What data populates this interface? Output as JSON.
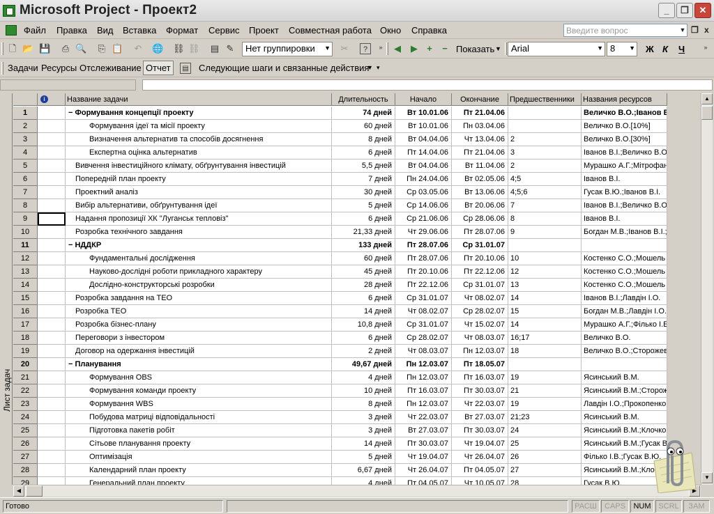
{
  "window": {
    "title": "Microsoft Project - Проект2"
  },
  "menu": [
    "Файл",
    "Правка",
    "Вид",
    "Вставка",
    "Формат",
    "Сервис",
    "Проект",
    "Совместная работа",
    "Окно",
    "Справка"
  ],
  "ask": {
    "placeholder": "Введите вопрос"
  },
  "toolbar": {
    "grouping": "Нет группировки",
    "show_label": "Показать",
    "font": "Arial",
    "font_size": "8",
    "bold_label": "Ж",
    "italic_label": "К",
    "underline_label": "Ч"
  },
  "project_guide": {
    "tabs": [
      "Задачи",
      "Ресурсы",
      "Отслеживание",
      "Отчет"
    ],
    "next_steps": "Следующие шаги и связанные действия"
  },
  "view_bar": {
    "label": "Лист задач"
  },
  "table": {
    "headers": [
      "Название задачи",
      "Длительность",
      "Начало",
      "Окончание",
      "Предшественники",
      "Названия ресурсов"
    ],
    "rows": [
      {
        "id": "1",
        "name": "Формування концепції проекту",
        "duration": "74 дней",
        "start": "Вт 10.01.06",
        "finish": "Пт 21.04.06",
        "pred": "",
        "res": "Величко В.О.;Іванов В",
        "summary": true,
        "level": 0
      },
      {
        "id": "2",
        "name": "Формування ідеї та місії  проекту",
        "duration": "60 дней",
        "start": "Вт 10.01.06",
        "finish": "Пн 03.04.06",
        "pred": "",
        "res": "Величко В.О.[10%]",
        "summary": false,
        "level": 2
      },
      {
        "id": "3",
        "name": "Визначення альтернатив та способів досягнення",
        "duration": "8 дней",
        "start": "Вт 04.04.06",
        "finish": "Чт 13.04.06",
        "pred": "2",
        "res": "Величко В.О.[30%]",
        "summary": false,
        "level": 2
      },
      {
        "id": "4",
        "name": "Експертна оцінка альтернатив",
        "duration": "6 дней",
        "start": "Пт 14.04.06",
        "finish": "Пт 21.04.06",
        "pred": "3",
        "res": "Іванов В.І.;Величко В.О",
        "summary": false,
        "level": 2
      },
      {
        "id": "5",
        "name": "Вивчення інвестиційного клімату, обґрунтування інвестицій",
        "duration": "5,5 дней",
        "start": "Вт 04.04.06",
        "finish": "Вт 11.04.06",
        "pred": "2",
        "res": "Мурашко А.Г.;Мітрофан",
        "summary": false,
        "level": 1
      },
      {
        "id": "6",
        "name": "Попередній план проекту",
        "duration": "7 дней",
        "start": "Пн 24.04.06",
        "finish": "Вт 02.05.06",
        "pred": "4;5",
        "res": "Іванов В.І.",
        "summary": false,
        "level": 1
      },
      {
        "id": "7",
        "name": "Проектний аналіз",
        "duration": "30 дней",
        "start": "Ср 03.05.06",
        "finish": "Вт 13.06.06",
        "pred": "4;5;6",
        "res": "Гусак В.Ю.;Іванов В.І.",
        "summary": false,
        "level": 1
      },
      {
        "id": "8",
        "name": "Вибір альтернативи, обґрунтування ідеї",
        "duration": "5 дней",
        "start": "Ср 14.06.06",
        "finish": "Вт 20.06.06",
        "pred": "7",
        "res": "Іванов В.І.;Величко В.О",
        "summary": false,
        "level": 1
      },
      {
        "id": "9",
        "name": "Надання пропозиції ХК \"Луганськ тепловіз\"",
        "duration": "6 дней",
        "start": "Ср 21.06.06",
        "finish": "Ср 28.06.06",
        "pred": "8",
        "res": "Іванов В.І.",
        "summary": false,
        "level": 1
      },
      {
        "id": "10",
        "name": "Розробка технічного завдання",
        "duration": "21,33 дней",
        "start": "Чт 29.06.06",
        "finish": "Пт 28.07.06",
        "pred": "9",
        "res": "Богдан М.В.;Іванов В.І.;",
        "summary": false,
        "level": 1
      },
      {
        "id": "11",
        "name": "НДДКР",
        "duration": "133 дней",
        "start": "Пт 28.07.06",
        "finish": "Ср 31.01.07",
        "pred": "",
        "res": "",
        "summary": true,
        "level": 0
      },
      {
        "id": "12",
        "name": "Фундаментальні дослідження",
        "duration": "60 дней",
        "start": "Пт 28.07.06",
        "finish": "Пт 20.10.06",
        "pred": "10",
        "res": "Костенко С.О.;Мошель",
        "summary": false,
        "level": 2
      },
      {
        "id": "13",
        "name": "Науково-дослідні роботи прикладного характеру",
        "duration": "45 дней",
        "start": "Пт 20.10.06",
        "finish": "Пт 22.12.06",
        "pred": "12",
        "res": "Костенко С.О.;Мошель",
        "summary": false,
        "level": 2
      },
      {
        "id": "14",
        "name": "Дослідно-конструкторські розробки",
        "duration": "28 дней",
        "start": "Пт 22.12.06",
        "finish": "Ср 31.01.07",
        "pred": "13",
        "res": "Костенко С.О.;Мошель",
        "summary": false,
        "level": 2
      },
      {
        "id": "15",
        "name": "Розробка завдання на ТЕО",
        "duration": "6 дней",
        "start": "Ср 31.01.07",
        "finish": "Чт 08.02.07",
        "pred": "14",
        "res": "Іванов В.І.;Лавдін І.О.",
        "summary": false,
        "level": 1
      },
      {
        "id": "16",
        "name": "Розробка ТЕО",
        "duration": "14 дней",
        "start": "Чт 08.02.07",
        "finish": "Ср 28.02.07",
        "pred": "15",
        "res": "Богдан М.В.;Лавдін І.О.;",
        "summary": false,
        "level": 1
      },
      {
        "id": "17",
        "name": "Розробка бізнес-плану",
        "duration": "10,8 дней",
        "start": "Ср 31.01.07",
        "finish": "Чт 15.02.07",
        "pred": "14",
        "res": "Мурашко А.Г.;Філько І.Е",
        "summary": false,
        "level": 1
      },
      {
        "id": "18",
        "name": "Переговори з інвестором",
        "duration": "6 дней",
        "start": "Ср 28.02.07",
        "finish": "Чт 08.03.07",
        "pred": "16;17",
        "res": "Величко В.О.",
        "summary": false,
        "level": 1
      },
      {
        "id": "19",
        "name": "Договор на одержання інвестицій",
        "duration": "2 дней",
        "start": "Чт 08.03.07",
        "finish": "Пн 12.03.07",
        "pred": "18",
        "res": "Величко В.О.;Сторожев",
        "summary": false,
        "level": 1
      },
      {
        "id": "20",
        "name": "Планування",
        "duration": "49,67 дней",
        "start": "Пн 12.03.07",
        "finish": "Пт 18.05.07",
        "pred": "",
        "res": "",
        "summary": true,
        "level": 0
      },
      {
        "id": "21",
        "name": "Формування OBS",
        "duration": "4 дней",
        "start": "Пн 12.03.07",
        "finish": "Пт 16.03.07",
        "pred": "19",
        "res": "Ясинський В.М.",
        "summary": false,
        "level": 2
      },
      {
        "id": "22",
        "name": "Формування команди проекту",
        "duration": "10 дней",
        "start": "Пт 16.03.07",
        "finish": "Пт 30.03.07",
        "pred": "21",
        "res": "Ясинський В.М.;Сторож",
        "summary": false,
        "level": 2
      },
      {
        "id": "23",
        "name": "Формування WBS",
        "duration": "8 дней",
        "start": "Пн 12.03.07",
        "finish": "Чт 22.03.07",
        "pred": "19",
        "res": "Лавдін І.О.;Прокопенко",
        "summary": false,
        "level": 2
      },
      {
        "id": "24",
        "name": "Побудова матриці відповідальності",
        "duration": "3 дней",
        "start": "Чт 22.03.07",
        "finish": "Вт 27.03.07",
        "pred": "21;23",
        "res": "Ясинський В.М.",
        "summary": false,
        "level": 2
      },
      {
        "id": "25",
        "name": "Підготовка пакетів робіт",
        "duration": "3 дней",
        "start": "Вт 27.03.07",
        "finish": "Пт 30.03.07",
        "pred": "24",
        "res": "Ясинський В.М.;Клочко",
        "summary": false,
        "level": 2
      },
      {
        "id": "26",
        "name": "Сітьове планування проекту",
        "duration": "14 дней",
        "start": "Пт 30.03.07",
        "finish": "Чт 19.04.07",
        "pred": "25",
        "res": "Ясинський В.М.;Гусак В.",
        "summary": false,
        "level": 2
      },
      {
        "id": "27",
        "name": "Оптимізація",
        "duration": "5 дней",
        "start": "Чт 19.04.07",
        "finish": "Чт 26.04.07",
        "pred": "26",
        "res": "Філько І.В.;Гусак В.Ю.",
        "summary": false,
        "level": 2
      },
      {
        "id": "28",
        "name": "Календарний план проекту",
        "duration": "6,67 дней",
        "start": "Чт 26.04.07",
        "finish": "Пт 04.05.07",
        "pred": "27",
        "res": "Ясинський В.М.;Клочко",
        "summary": false,
        "level": 2
      },
      {
        "id": "29",
        "name": "Генеральний план проекту",
        "duration": "4 дней",
        "start": "Пт 04.05.07",
        "finish": "Чт 10.05.07",
        "pred": "28",
        "res": "Гусак В.Ю.",
        "summary": false,
        "level": 2
      }
    ]
  },
  "status": {
    "text": "Готово",
    "indicators": [
      {
        "label": "РАСШ",
        "active": false
      },
      {
        "label": "CAPS",
        "active": false
      },
      {
        "label": "NUM",
        "active": true
      },
      {
        "label": "SCRL",
        "active": false
      },
      {
        "label": "ЗАМ",
        "active": false
      }
    ]
  }
}
